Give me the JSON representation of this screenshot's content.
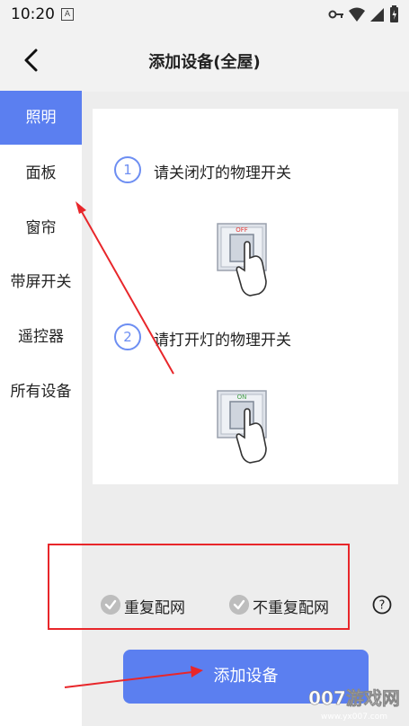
{
  "status_bar": {
    "time": "10:20",
    "a_icon": "A"
  },
  "header": {
    "title": "添加设备(全屋)"
  },
  "sidebar": {
    "items": [
      {
        "label": "照明",
        "active": true
      },
      {
        "label": "面板"
      },
      {
        "label": "窗帘"
      },
      {
        "label": "带屏开关"
      },
      {
        "label": "遥控器"
      },
      {
        "label": "所有设备"
      }
    ]
  },
  "steps": [
    {
      "num": "1",
      "text": "请关闭灯的物理开关",
      "switch_label": "OFF"
    },
    {
      "num": "2",
      "text": "请打开灯的物理开关",
      "switch_label": "ON"
    }
  ],
  "options": [
    {
      "label": "重复配网"
    },
    {
      "label": "不重复配网"
    }
  ],
  "help_icon_glyph": "?",
  "primary_button": {
    "label": "添加设备"
  },
  "watermark": {
    "main": "007游戏网",
    "sub": "www.yx007.com"
  },
  "colors": {
    "accent": "#5b7ff0",
    "annotation": "#e8262a",
    "off_label": "#e53935",
    "on_label": "#43a047"
  }
}
